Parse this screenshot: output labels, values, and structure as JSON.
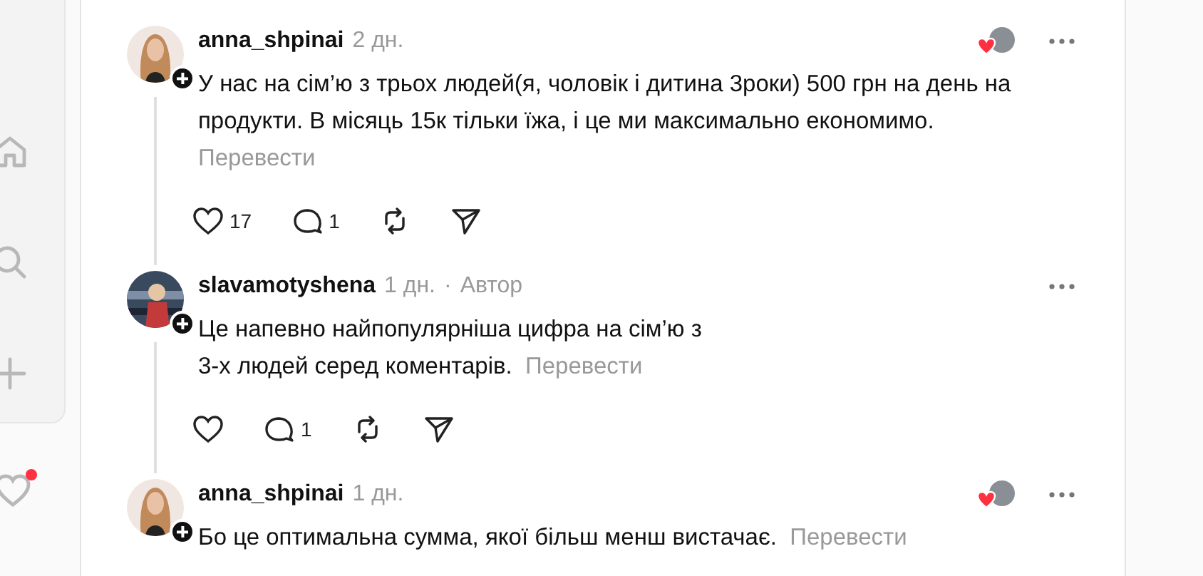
{
  "sidebar": {
    "notification": true
  },
  "comments": [
    {
      "username": "anna_shpinai",
      "time": "2 дн.",
      "text": "У нас на сім’ю з трьох людей(я, чоловік і дитина 3роки) 500 грн на день на продукти. В місяць 15к тільки їжа, і це ми максимально економимо.",
      "translate": "Перевести",
      "liked_by_author": true,
      "actions": {
        "likes": "17",
        "replies": "1"
      }
    },
    {
      "username": "slavamotyshena",
      "time": "1 дн.",
      "separator": "·",
      "author_label": "Автор",
      "text": "Це напевно найпопулярніша цифра на сім’ю з 3-х людей серед коментарів.",
      "translate": "Перевести",
      "liked_by_author": false,
      "actions": {
        "replies": "1"
      }
    },
    {
      "username": "anna_shpinai",
      "time": "1 дн.",
      "text": "Бо це оптимальна сумма, якої більш менш вистачає.",
      "translate": "Перевести",
      "liked_by_author": true
    }
  ]
}
